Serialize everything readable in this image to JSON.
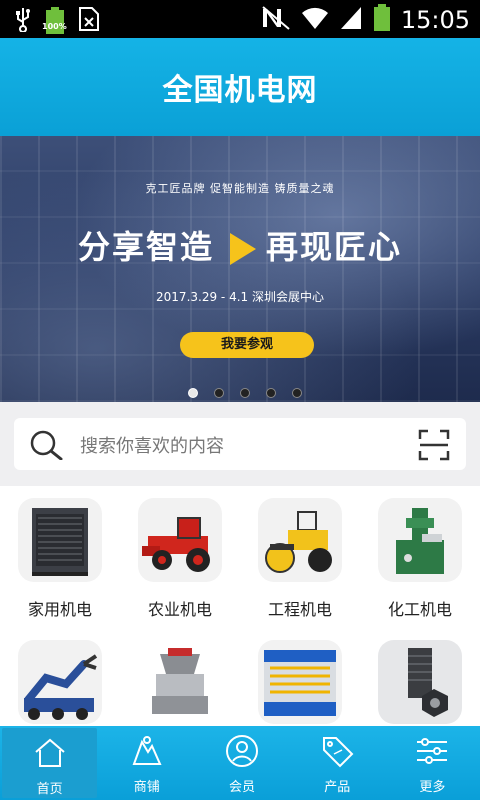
{
  "status_bar": {
    "battery_left": "100%",
    "time": "15:05"
  },
  "header": {
    "title": "全国机电网"
  },
  "banner": {
    "tagline": "克工匠品牌  促智能制造  铸质量之魂",
    "headline_part1": "分享智造",
    "headline_part2": "再现匠心",
    "date_place": "2017.3.29 - 4.1    深圳会展中心",
    "cta": "我要参观",
    "dots_count": 5,
    "active_dot": 0
  },
  "search": {
    "placeholder": "搜索你喜欢的内容"
  },
  "categories": [
    {
      "label": "家用机电",
      "icon": "heat-pump-unit-image"
    },
    {
      "label": "农业机电",
      "icon": "harvester-image"
    },
    {
      "label": "工程机电",
      "icon": "road-roller-image"
    },
    {
      "label": "化工机电",
      "icon": "grinding-machine-image"
    },
    {
      "label": "",
      "icon": "robot-arm-image"
    },
    {
      "label": "",
      "icon": "cone-crusher-image"
    },
    {
      "label": "",
      "icon": "conveyor-machine-image"
    },
    {
      "label": "",
      "icon": "bolt-nut-image"
    }
  ],
  "tabbar": {
    "items": [
      {
        "label": "首页",
        "icon": "home-icon",
        "active": true
      },
      {
        "label": "商铺",
        "icon": "shop-icon",
        "active": false
      },
      {
        "label": "会员",
        "icon": "member-icon",
        "active": false
      },
      {
        "label": "产品",
        "icon": "sale-tag-icon",
        "active": false
      },
      {
        "label": "更多",
        "icon": "settings-sliders-icon",
        "active": false
      }
    ]
  }
}
